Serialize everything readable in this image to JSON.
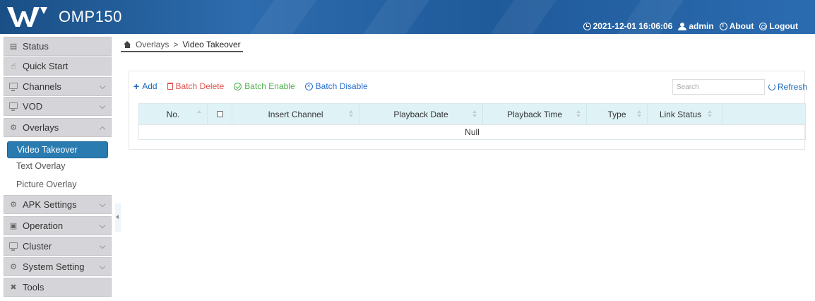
{
  "header": {
    "app_title": "OMP150",
    "datetime": "2021-12-01 16:06:06",
    "user": "admin",
    "about": "About",
    "logout": "Logout",
    "bg_color": "#2d6cae"
  },
  "sidebar": {
    "items": [
      {
        "label": "Status",
        "icon": "status-icon"
      },
      {
        "label": "Quick Start",
        "icon": "hand-icon"
      },
      {
        "label": "Channels",
        "icon": "monitor-icon"
      },
      {
        "label": "VOD",
        "icon": "monitor-icon"
      },
      {
        "label": "Overlays",
        "icon": "gear-icon"
      },
      {
        "label": "APK Settings",
        "icon": "gear-icon"
      },
      {
        "label": "Operation",
        "icon": "screen-icon"
      },
      {
        "label": "Cluster",
        "icon": "monitor-icon"
      },
      {
        "label": "System Setting",
        "icon": "gear-icon"
      },
      {
        "label": "Tools",
        "icon": "tools-icon"
      }
    ],
    "overlays_sub": [
      {
        "label": "Video Takeover",
        "active": true
      },
      {
        "label": "Text Overlay",
        "active": false
      },
      {
        "label": "Picture Overlay",
        "active": false
      }
    ],
    "active_color": "#2a7bb0"
  },
  "breadcrumb": {
    "parent": "Overlays",
    "separator": ">",
    "current": "Video Takeover"
  },
  "toolbar": {
    "add": "Add",
    "batch_delete": "Batch Delete",
    "batch_enable": "Batch Enable",
    "batch_disable": "Batch Disable",
    "search_placeholder": "Search",
    "refresh": "Refresh"
  },
  "table": {
    "columns": [
      "No.",
      "",
      "Insert Channel",
      "Playback Date",
      "Playback Time",
      "Type",
      "Link Status",
      ""
    ],
    "empty_text": "Null"
  }
}
